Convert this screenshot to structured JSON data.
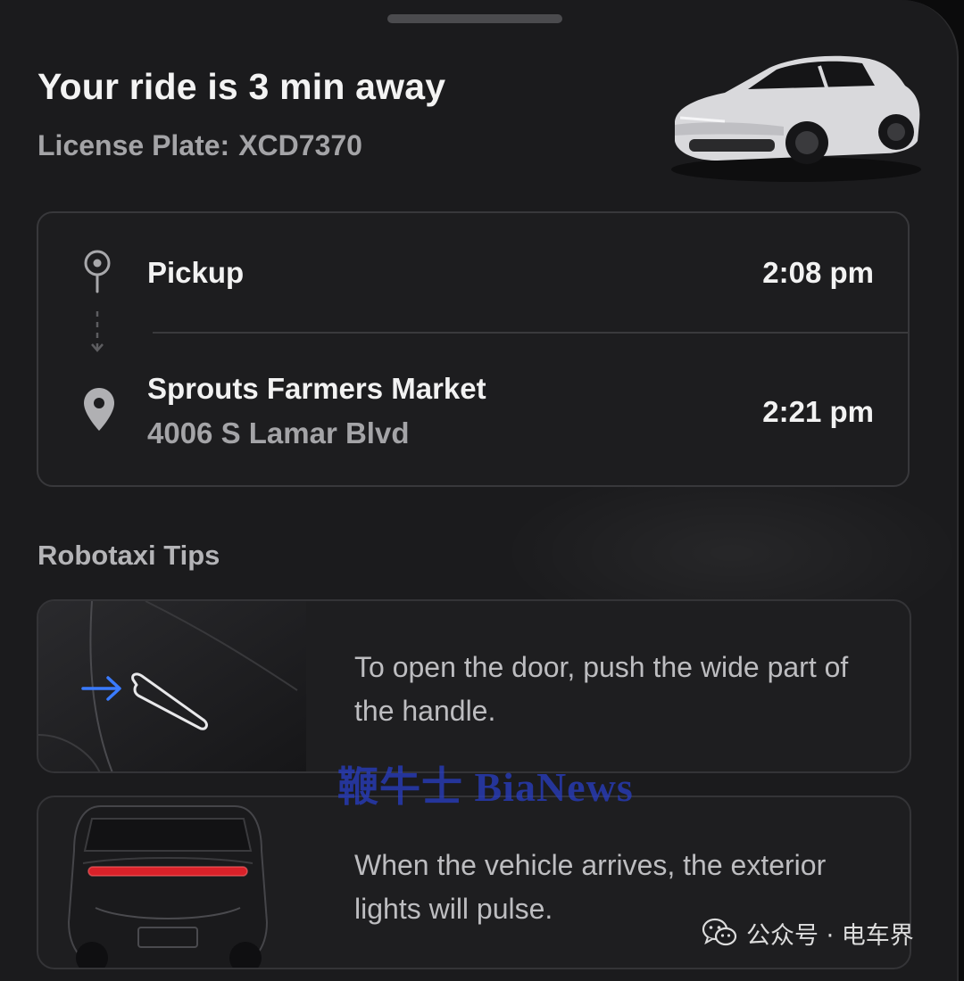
{
  "sheet": {
    "title": "Your ride is 3 min away",
    "plate_label": "License Plate:",
    "plate_value": "XCD7370"
  },
  "trip": {
    "pickup": {
      "label": "Pickup",
      "time": "2:08 pm",
      "icon": "pickup-marker-icon"
    },
    "destination": {
      "name": "Sprouts Farmers Market",
      "address": "4006 S Lamar Blvd",
      "time": "2:21 pm",
      "icon": "location-pin-icon"
    }
  },
  "tips": {
    "heading": "Robotaxi Tips",
    "items": [
      {
        "text": "To open the door, push the wide part of the handle.",
        "image": "door-handle-illustration",
        "accent": "#3a7bff"
      },
      {
        "text": "When the vehicle arrives, the exterior lights will pulse.",
        "image": "rear-lights-illustration",
        "accent": "#e0262b"
      }
    ]
  },
  "overlay": {
    "watermark": "鞭牛士 BiaNews",
    "account": "公众号 · 电车界"
  }
}
